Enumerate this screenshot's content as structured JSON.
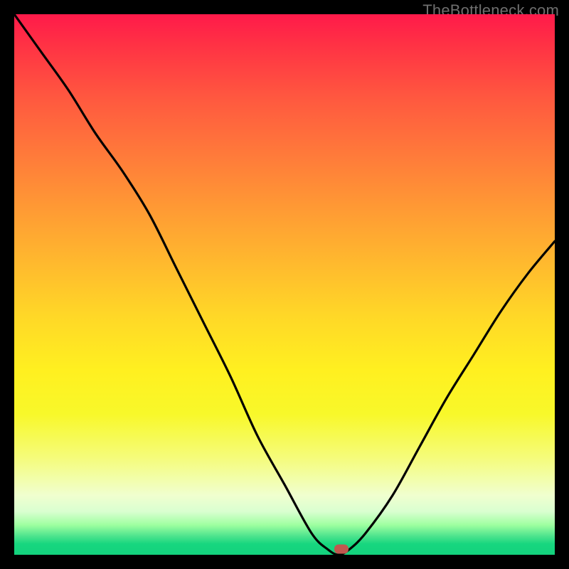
{
  "watermark": "TheBottleneck.com",
  "marker": {
    "x_frac": 0.605,
    "y_frac": 0.989
  },
  "chart_data": {
    "type": "line",
    "title": "",
    "xlabel": "",
    "ylabel": "",
    "xlim": [
      0,
      100
    ],
    "ylim": [
      0,
      100
    ],
    "x_meaning": "normalized horizontal position (0 = left edge, 100 = right edge)",
    "y_meaning": "bottleneck percentage (0 = bottom/green/no bottleneck, 100 = top/red/severe bottleneck)",
    "series": [
      {
        "name": "bottleneck-curve",
        "x": [
          0,
          5,
          10,
          15,
          20,
          25,
          30,
          35,
          40,
          45,
          50,
          55,
          58,
          60,
          62,
          65,
          70,
          75,
          80,
          85,
          90,
          95,
          100
        ],
        "values": [
          100,
          93,
          86,
          78,
          71,
          63,
          53,
          43,
          33,
          22,
          13,
          4,
          1,
          0,
          1,
          4,
          11,
          20,
          29,
          37,
          45,
          52,
          58
        ]
      }
    ],
    "bottleneck_minimum": {
      "x": 60.5,
      "bottleneck_pct": 0
    },
    "annotations": []
  }
}
